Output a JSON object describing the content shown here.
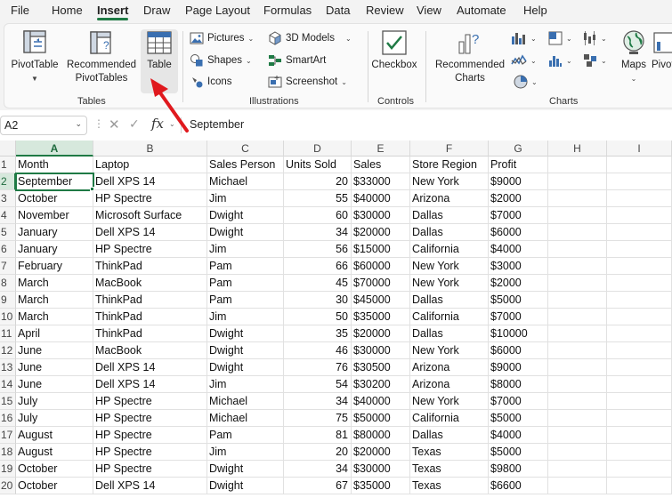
{
  "menu": [
    "File",
    "Home",
    "Insert",
    "Draw",
    "Page Layout",
    "Formulas",
    "Data",
    "Review",
    "View",
    "Automate",
    "Help"
  ],
  "active_menu": "Insert",
  "ribbon": {
    "tables": {
      "pivottable": "PivotTable",
      "recommended_pivot": [
        "Recommended",
        "PivotTables"
      ],
      "table": "Table",
      "group_label": "Tables"
    },
    "illustrations": {
      "pictures": "Pictures",
      "shapes": "Shapes",
      "icons": "Icons",
      "models3d": "3D Models",
      "smartart": "SmartArt",
      "screenshot": "Screenshot",
      "group_label": "Illustrations"
    },
    "controls": {
      "checkbox": "Checkbox",
      "group_label": "Controls"
    },
    "charts": {
      "recommended": [
        "Recommended",
        "Charts"
      ],
      "maps": "Maps",
      "pivotchart": "Pivot",
      "group_label": "Charts"
    }
  },
  "formula_bar": {
    "name_box": "A2",
    "fx": "fx",
    "value": "September"
  },
  "grid": {
    "columns": [
      "A",
      "B",
      "C",
      "D",
      "E",
      "F",
      "G",
      "H",
      "I"
    ],
    "selected_column": "A",
    "selected_row": "2",
    "active_cell": "A2",
    "header": [
      "Month",
      "Laptop",
      "Sales Person",
      "Units Sold",
      "Sales",
      "Store Region",
      "Profit"
    ],
    "rows": [
      [
        "September",
        "Dell XPS 14",
        "Michael",
        "20",
        "$33000",
        "New York",
        "$9000"
      ],
      [
        "October",
        "HP Spectre",
        "Jim",
        "55",
        "$40000",
        "Arizona",
        "$2000"
      ],
      [
        "November",
        "Microsoft Surface",
        "Dwight",
        "60",
        "$30000",
        "Dallas",
        "$7000"
      ],
      [
        "January",
        "Dell XPS 14",
        "Dwight",
        "34",
        "$20000",
        "Dallas",
        "$6000"
      ],
      [
        "January",
        "HP Spectre",
        "Jim",
        "56",
        "$15000",
        "California",
        "$4000"
      ],
      [
        "February",
        "ThinkPad",
        "Pam",
        "66",
        "$60000",
        "New York",
        "$3000"
      ],
      [
        "March",
        "MacBook",
        "Pam",
        "45",
        "$70000",
        "New York",
        "$2000"
      ],
      [
        "March",
        "ThinkPad",
        "Pam",
        "30",
        "$45000",
        "Dallas",
        "$5000"
      ],
      [
        "March",
        "ThinkPad",
        "Jim",
        "50",
        "$35000",
        "California",
        "$7000"
      ],
      [
        "April",
        "ThinkPad",
        "Dwight",
        "35",
        "$20000",
        "Dallas",
        "$10000"
      ],
      [
        "June",
        "MacBook",
        "Dwight",
        "46",
        "$30000",
        "New York",
        "$6000"
      ],
      [
        "June",
        "Dell XPS 14",
        "Dwight",
        "76",
        "$30500",
        "Arizona",
        "$9000"
      ],
      [
        "June",
        "Dell XPS 14",
        "Jim",
        "54",
        "$30200",
        "Arizona",
        "$8000"
      ],
      [
        "July",
        "HP Spectre",
        "Michael",
        "34",
        "$40000",
        "New York",
        "$7000"
      ],
      [
        "July",
        "HP Spectre",
        "Michael",
        "75",
        "$50000",
        "California",
        "$5000"
      ],
      [
        "August",
        "HP Spectre",
        "Pam",
        "81",
        "$80000",
        "Dallas",
        "$4000"
      ],
      [
        "August",
        "HP Spectre",
        "Jim",
        "20",
        "$20000",
        "Texas",
        "$5000"
      ],
      [
        "October",
        "HP Spectre",
        "Dwight",
        "34",
        "$30000",
        "Texas",
        "$9800"
      ],
      [
        "October",
        "Dell XPS 14",
        "Dwight",
        "67",
        "$35000",
        "Texas",
        "$6600"
      ]
    ]
  },
  "colors": {
    "accent": "#1f7a45",
    "annotation_arrow": "#e0191e"
  }
}
